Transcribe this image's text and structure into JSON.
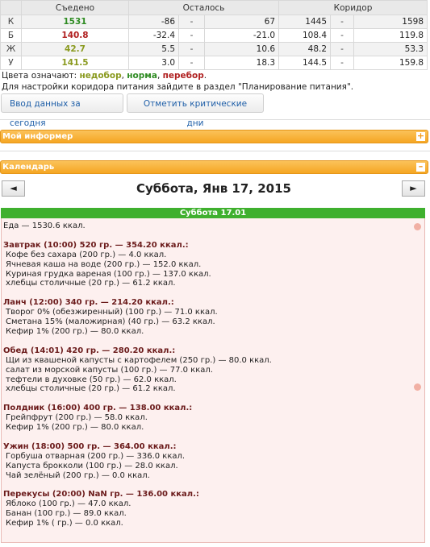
{
  "table": {
    "headers": {
      "eaten": "Съедено",
      "remaining": "Осталось",
      "corridor": "Коридор"
    },
    "rows": [
      {
        "letter": "К",
        "eaten": "1531",
        "eaten_color": "#2e8b22",
        "rem_a": "-86",
        "rem_sep": "-",
        "rem_b": "67",
        "cor_a": "1445",
        "cor_sep": "-",
        "cor_b": "1598"
      },
      {
        "letter": "Б",
        "eaten": "140.8",
        "eaten_color": "#b02020",
        "rem_a": "-32.4",
        "rem_sep": "-",
        "rem_b": "-21.0",
        "cor_a": "108.4",
        "cor_sep": "-",
        "cor_b": "119.8"
      },
      {
        "letter": "Ж",
        "eaten": "42.7",
        "eaten_color": "#8a9a1f",
        "rem_a": "5.5",
        "rem_sep": "-",
        "rem_b": "10.6",
        "cor_a": "48.2",
        "cor_sep": "-",
        "cor_b": "53.3"
      },
      {
        "letter": "У",
        "eaten": "141.5",
        "eaten_color": "#8a9a1f",
        "rem_a": "3.0",
        "rem_sep": "-",
        "rem_b": "18.3",
        "cor_a": "144.5",
        "cor_sep": "-",
        "cor_b": "159.8"
      }
    ]
  },
  "legend": {
    "prefix": "Цвета означают: ",
    "under": "недобор",
    "sep1": ", ",
    "norm": "норма",
    "sep2": ", ",
    "over": "перебор",
    "end": "."
  },
  "hint": "Для настройки коридора питания зайдите в раздел \"Планирование питания\".",
  "buttons": {
    "today": "Ввод данных за сегодня",
    "critical": "Отметить критические дни"
  },
  "informer": {
    "title": "Мой информер",
    "toggle": "+"
  },
  "calendar": {
    "title": "Календарь",
    "toggle": "–",
    "prev": "◄",
    "next": "►",
    "date": "Суббота, Янв 17, 2015"
  },
  "day": {
    "header": "Суббота 17.01",
    "total": "Еда — 1530.6 ккал.",
    "meals": [
      {
        "title": "Завтрак (10:00) 520 гр. — 354.20 ккал.:",
        "items": [
          "Кофе без сахара (200 гр.) — 4.0 ккал.",
          "Ячневая каша на воде (200 гр.) — 152.0 ккал.",
          "Куриная грудка вареная (100 гр.) — 137.0 ккал.",
          "хлебцы столичные (20 гр.) — 61.2 ккал."
        ]
      },
      {
        "title": "Ланч (12:00) 340 гр. — 214.20 ккал.:",
        "items": [
          "Творог 0% (обезжиренный) (100 гр.) — 71.0 ккал.",
          "Сметана 15% (маложирная) (40 гр.) — 63.2 ккал.",
          "Кефир 1% (200 гр.) — 80.0 ккал."
        ]
      },
      {
        "title": "Обед (14:01) 420 гр. — 280.20 ккал.:",
        "items": [
          "Щи из квашеной капусты с картофелем (250 гр.) — 80.0 ккал.",
          "салат из морской капусты (100 гр.) — 77.0 ккал.",
          "тефтели в духовке (50 гр.) — 62.0 ккал.",
          "хлебцы столичные (20 гр.) — 61.2 ккал."
        ]
      },
      {
        "title": "Полдник (16:00) 400 гр. — 138.00 ккал.:",
        "items": [
          "Грейпфрут (200 гр.) — 58.0 ккал.",
          "Кефир 1% (200 гр.) — 80.0 ккал."
        ]
      },
      {
        "title": "Ужин (18:00) 500 гр. — 364.00 ккал.:",
        "items": [
          "Горбуша отварная (200 гр.) — 336.0 ккал.",
          "Капуста брокколи (100 гр.) — 28.0 ккал.",
          "Чай зелёный (200 гр.) — 0.0 ккал."
        ]
      },
      {
        "title": "Перекусы (20:00) NaN гр. — 136.00 ккал.:",
        "items": [
          "Яблоко (100 гр.) — 47.0 ккал.",
          "Банан (100 гр.) — 89.0 ккал.",
          "Кефир 1% ( гр.) — 0.0 ккал."
        ]
      }
    ]
  }
}
